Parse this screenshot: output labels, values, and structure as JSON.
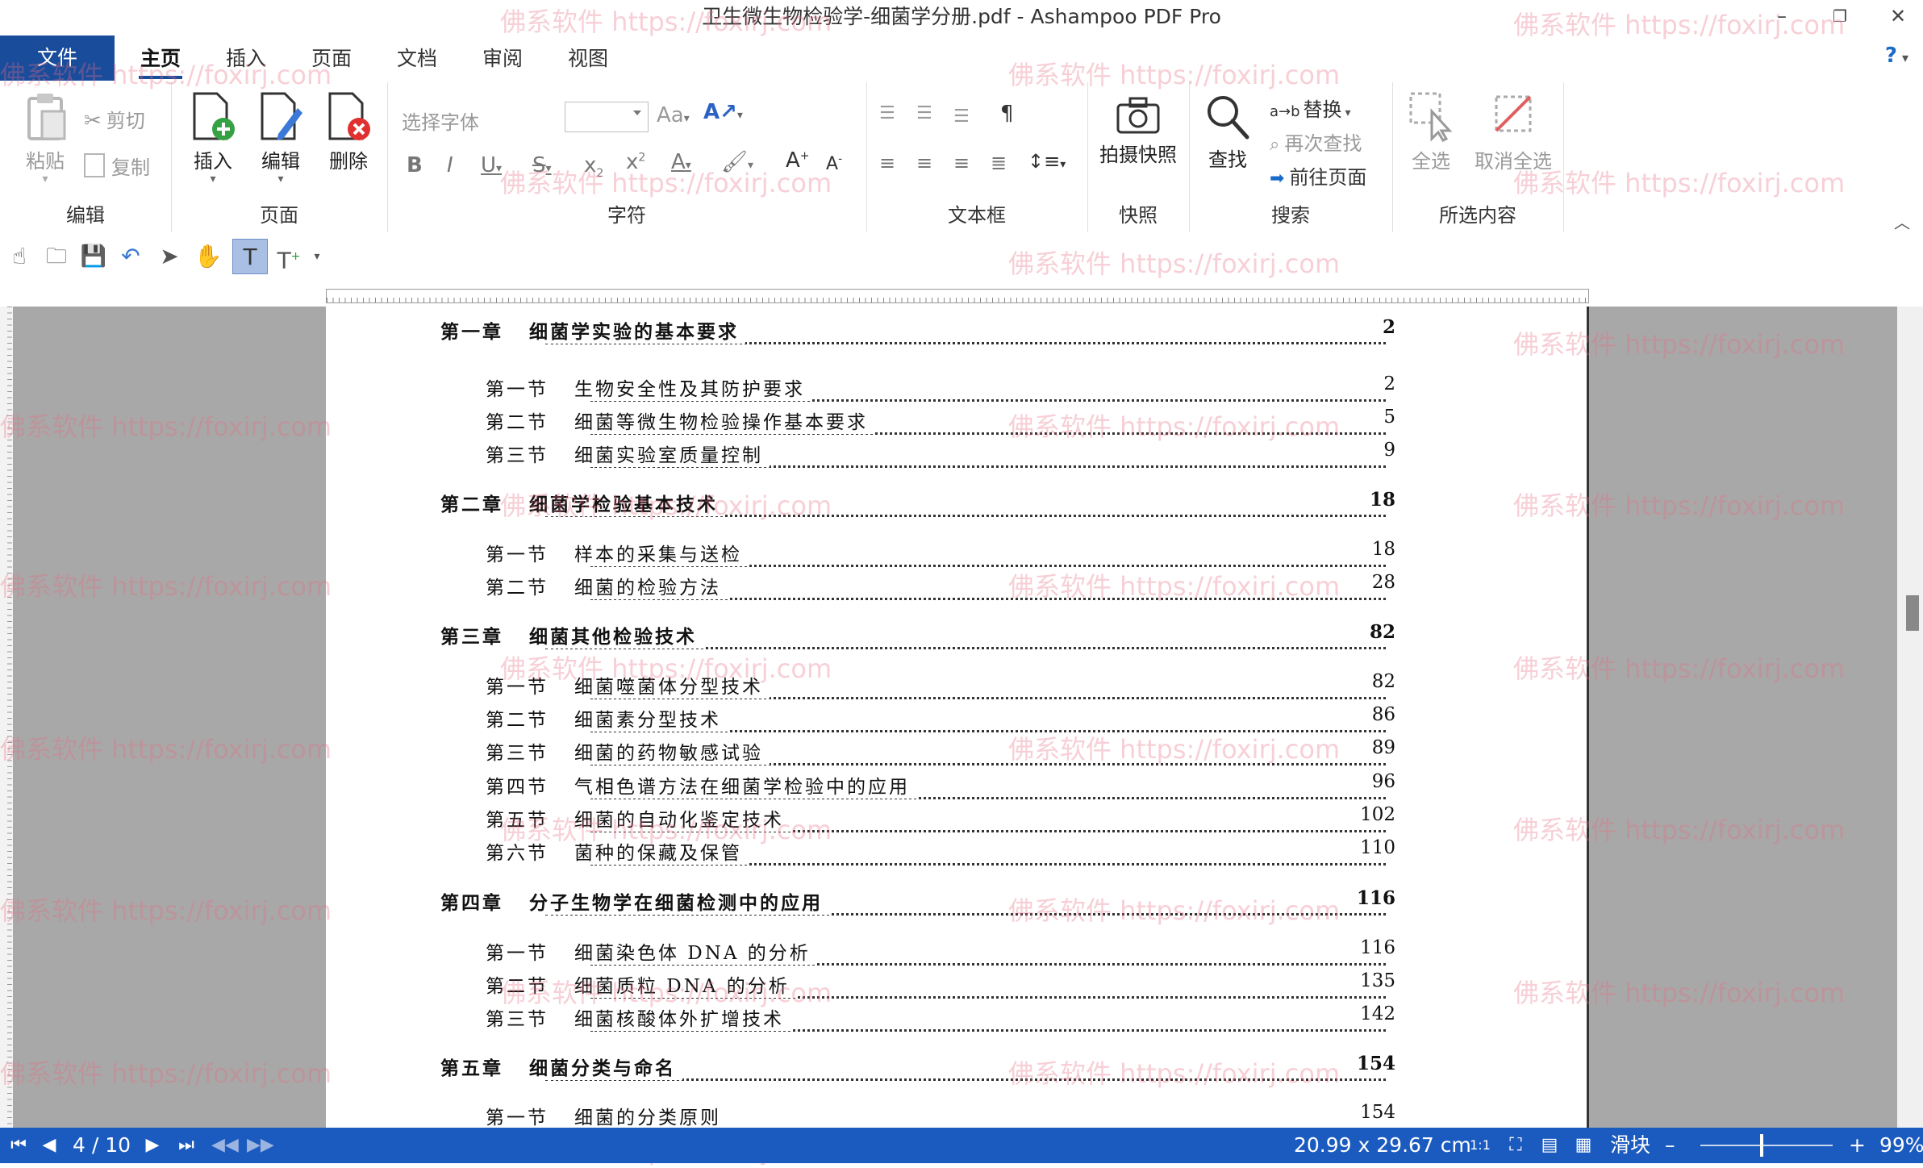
{
  "window": {
    "title": "卫生微生物检验学-细菌学分册.pdf - Ashampoo PDF Pro",
    "min_glyph": "–",
    "restore_glyph": "❐",
    "close_glyph": "✕"
  },
  "menu": {
    "file": "文件",
    "tabs": [
      "主页",
      "插入",
      "页面",
      "文档",
      "审阅",
      "视图"
    ],
    "help": "?"
  },
  "ribbon": {
    "edit": {
      "label": "编辑",
      "paste": "粘贴",
      "cut": "剪切",
      "copy": "复制"
    },
    "page": {
      "label": "页面",
      "insert": "插入",
      "edit": "编辑",
      "delete": "删除"
    },
    "font": {
      "label": "字符",
      "placeholder": "选择字体",
      "size": ""
    },
    "textbox": {
      "label": "文本框"
    },
    "snapshot": {
      "label": "快照",
      "button": "拍摄快照"
    },
    "search": {
      "label": "搜索",
      "find": "查找",
      "replace": "替换",
      "find_again": "再次查找",
      "goto": "前往页面"
    },
    "selection": {
      "label": "所选内容",
      "select_all": "全选",
      "deselect_all": "取消全选"
    }
  },
  "toc": {
    "entries": [
      {
        "kind": "chapter",
        "label": "第一章",
        "title": "细菌学实验的基本要求",
        "page": "2"
      },
      {
        "kind": "section",
        "label": "第一节",
        "title": "生物安全性及其防护要求",
        "page": "2"
      },
      {
        "kind": "section",
        "label": "第二节",
        "title": "细菌等微生物检验操作基本要求",
        "page": "5"
      },
      {
        "kind": "section",
        "label": "第三节",
        "title": "细菌实验室质量控制",
        "page": "9"
      },
      {
        "kind": "chapter",
        "label": "第二章",
        "title": "细菌学检验基本技术",
        "page": "18"
      },
      {
        "kind": "section",
        "label": "第一节",
        "title": "样本的采集与送检",
        "page": "18"
      },
      {
        "kind": "section",
        "label": "第二节",
        "title": "细菌的检验方法",
        "page": "28"
      },
      {
        "kind": "chapter",
        "label": "第三章",
        "title": "细菌其他检验技术",
        "page": "82"
      },
      {
        "kind": "section",
        "label": "第一节",
        "title": "细菌噬菌体分型技术",
        "page": "82"
      },
      {
        "kind": "section",
        "label": "第二节",
        "title": "细菌素分型技术",
        "page": "86"
      },
      {
        "kind": "section",
        "label": "第三节",
        "title": "细菌的药物敏感试验",
        "page": "89"
      },
      {
        "kind": "section",
        "label": "第四节",
        "title": "气相色谱方法在细菌学检验中的应用",
        "page": "96"
      },
      {
        "kind": "section",
        "label": "第五节",
        "title": "细菌的自动化鉴定技术",
        "page": "102"
      },
      {
        "kind": "section",
        "label": "第六节",
        "title": "菌种的保藏及保管",
        "page": "110"
      },
      {
        "kind": "chapter",
        "label": "第四章",
        "title": "分子生物学在细菌检测中的应用",
        "page": "116"
      },
      {
        "kind": "section",
        "label": "第一节",
        "title": "细菌染色体 DNA 的分析",
        "page": "116"
      },
      {
        "kind": "section",
        "label": "第二节",
        "title": "细菌质粒 DNA 的分析",
        "page": "135"
      },
      {
        "kind": "section",
        "label": "第三节",
        "title": "细菌核酸体外扩增技术",
        "page": "142"
      },
      {
        "kind": "chapter",
        "label": "第五章",
        "title": "细菌分类与命名",
        "page": "154"
      },
      {
        "kind": "section",
        "label": "第一节",
        "title": "细菌的分类原则",
        "page": "154"
      }
    ]
  },
  "status": {
    "page_indicator": "4 / 10",
    "page_size": "20.99 x 29.67 cm",
    "slider_label": "滑块",
    "zoom_minus": "–",
    "zoom_plus": "+",
    "zoom": "99%",
    "zoom_fraction": 0.45
  },
  "watermark": "佛系软件 https://foxirj.com",
  "colors": {
    "accent": "#1a4c9c",
    "status": "#1b5bbf",
    "workspace": "#a8a8a8"
  }
}
